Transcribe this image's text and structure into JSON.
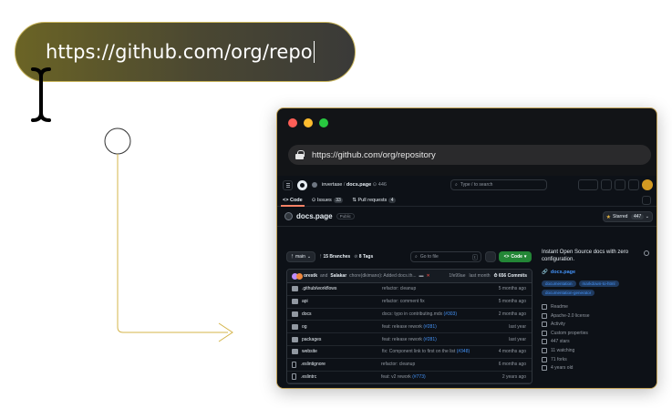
{
  "hero": {
    "url_text": "https://github.com/org/repo"
  },
  "browser": {
    "address": "https://github.com/org/repository"
  },
  "github": {
    "breadcrumb": {
      "owner": "invertase",
      "separator": "/",
      "repo": "docs.page",
      "stars_hint": "446"
    },
    "search_placeholder": "Type / to search",
    "tabs": [
      {
        "label": "Code",
        "count": ""
      },
      {
        "label": "Issues",
        "count": "33"
      },
      {
        "label": "Pull requests",
        "count": "4"
      }
    ],
    "repo": {
      "name": "docs.page",
      "visibility": "Public",
      "starred_label": "Starred",
      "star_count": "447"
    },
    "controls": {
      "branch": "main",
      "branches": "15 Branches",
      "tags": "8 Tags",
      "goto_placeholder": "Go to file",
      "goto_key": "t",
      "code_label": "Code"
    },
    "commit": {
      "author1": "orestk",
      "and": "and",
      "author2": "Salakar",
      "message": "chore(dkimano): Added docs.th...",
      "hash": "1fe99ae",
      "when": "last month",
      "commits": "656 Commits"
    },
    "files": [
      {
        "name": ".github/workflows",
        "msg": "refactor: cleanup",
        "link": "",
        "time": "5 months ago",
        "type": "dir"
      },
      {
        "name": "api",
        "msg": "refactor: comment fix",
        "link": "",
        "time": "5 months ago",
        "type": "dir"
      },
      {
        "name": "docs",
        "msg": "docs: typo in contributing.mdx",
        "link": "(#303)",
        "time": "2 months ago",
        "type": "dir"
      },
      {
        "name": "og",
        "msg": "feat: release rework",
        "link": "(#281)",
        "time": "last year",
        "type": "dir"
      },
      {
        "name": "packages",
        "msg": "feat: release rework",
        "link": "(#281)",
        "time": "last year",
        "type": "dir"
      },
      {
        "name": "website",
        "msg": "fix: Component link to first on the list",
        "link": "(#348)",
        "time": "4 months ago",
        "type": "dir"
      },
      {
        "name": ".eslintignore",
        "msg": "refactor: cleanup",
        "link": "",
        "time": "6 months ago",
        "type": "file"
      },
      {
        "name": ".eslintrc",
        "msg": "feat: v2 rework",
        "link": "(#773)",
        "time": "2 years ago",
        "type": "file"
      }
    ],
    "about": {
      "description": "Instant Open Source docs with zero configuration.",
      "website": "docs.page",
      "topics": [
        "documentation",
        "markdown-to-html",
        "documentation-generator"
      ],
      "meta": [
        "Readme",
        "Apache-2.0 license",
        "Activity",
        "Custom properties",
        "447 stars",
        "11 watching",
        "71 forks",
        "4 years old"
      ]
    }
  },
  "colors": {
    "accent_gold": "#c8b45a",
    "github_bg": "#0d1117",
    "code_button": "#238636",
    "link": "#4493f8"
  }
}
